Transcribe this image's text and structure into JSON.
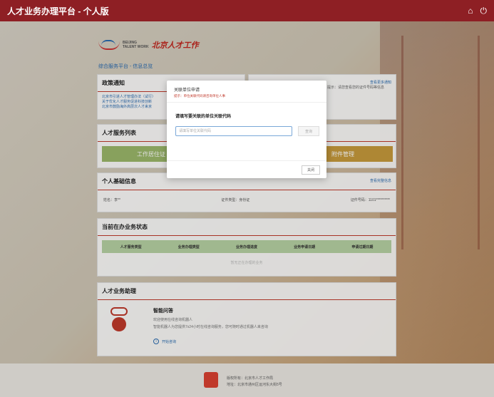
{
  "header": {
    "title": "人才业务办理平台 - 个人版",
    "home_icon": "home-icon",
    "power_icon": "power-icon"
  },
  "logo": {
    "en_line1": "BEIJING",
    "en_line2": "TALENT WORK",
    "cn": "北京人才工作"
  },
  "breadcrumb": "综合服务平台 - 信息总览",
  "policy": {
    "title": "政策通知",
    "items": [
      "北京市引进人才管理办法（试行）",
      "关于优化人才服务促进科技创新",
      "北京市鼓励海外高层次人才来京"
    ]
  },
  "notice": {
    "more": "查看更多通知",
    "text": "提示：请您查看您的证件号码等信息"
  },
  "services": {
    "title": "人才服务列表",
    "btn_work": "工作居住证",
    "btn_file": "附件管理"
  },
  "basic": {
    "title": "个人基础信息",
    "more": "查看完整信息",
    "name_label": "姓名：",
    "name_value": "李**",
    "idtype": "证件类型：身份证",
    "idno_label": "证件号码：",
    "idno_value": "1101**********"
  },
  "status": {
    "title": "当前在办业务状态",
    "columns": [
      "人才服务类型",
      "业务办理类型",
      "业务办理进度",
      "业务申请日期",
      "申请过期日期"
    ],
    "empty": "暂无正在办理的业务"
  },
  "assist": {
    "title": "人才业务助理",
    "bot_name": "智能问答",
    "line1": "欢迎使用在线咨询机器人",
    "line2": "智能机器人为您提供7x24小时在线咨询服务，您可随时通过机器人来咨询",
    "consult": "开始咨询"
  },
  "footer": {
    "line1": "版权所有：北京市人才工作局",
    "line2": "地址：北京市通州区运河东大街5号"
  },
  "modal": {
    "title": "关联单位申请",
    "tip": "提示：单位关联代码请咨询单位人事",
    "label": "请填写要关联的单位关联代码",
    "input_placeholder": "请填写单位关联代码",
    "query": "查询",
    "close": "关闭"
  },
  "colors": {
    "brand": "#8e1f24",
    "accent": "#c0392b",
    "link": "#2b6cb0",
    "green": "#9bb86a",
    "gold": "#c69a3c"
  }
}
